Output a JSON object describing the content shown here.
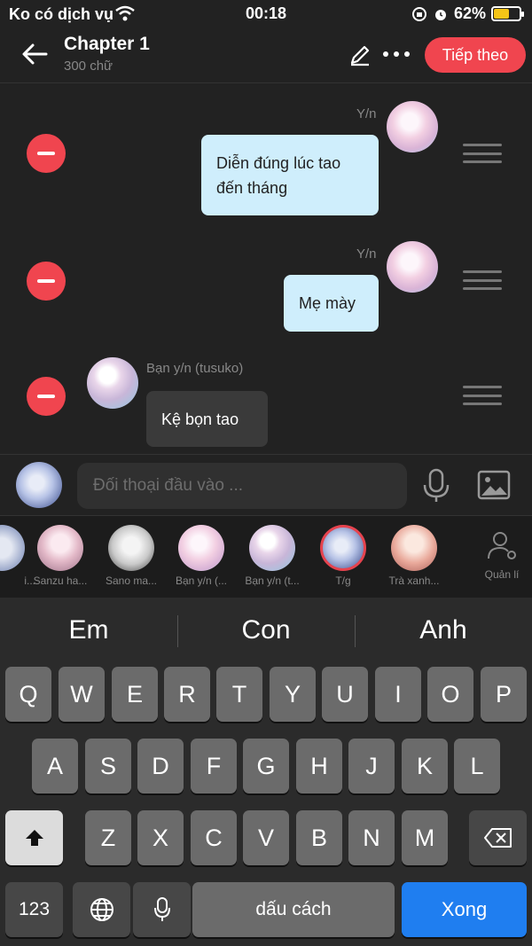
{
  "status_bar": {
    "carrier": "Ko có dịch vụ",
    "time": "00:18",
    "battery_percent": "62%",
    "battery_level": 0.62
  },
  "header": {
    "title": "Chapter 1",
    "subtitle": "300 chữ",
    "next_label": "Tiếp theo"
  },
  "messages": [
    {
      "sender": "Y/n",
      "text_lines": [
        "Diễn đúng lúc tao",
        "đến tháng"
      ],
      "side": "right"
    },
    {
      "sender": "Y/n",
      "text_lines": [
        "Mẹ mày"
      ],
      "side": "right"
    },
    {
      "sender": "Bạn y/n (tusuko)",
      "text_lines": [
        "Kệ bọn tao"
      ],
      "side": "left"
    }
  ],
  "composer": {
    "placeholder": "Đối thoại đầu vào ..."
  },
  "characters": [
    {
      "label": "i..."
    },
    {
      "label": "Sanzu ha..."
    },
    {
      "label": "Sano ma..."
    },
    {
      "label": "Bạn y/n (..."
    },
    {
      "label": "Bạn y/n (t..."
    },
    {
      "label": "T/g"
    },
    {
      "label": "Trà xanh..."
    }
  ],
  "manage_label": "Quản lí",
  "keyboard": {
    "suggestions": [
      "Em",
      "Con",
      "Anh"
    ],
    "row1": [
      "Q",
      "W",
      "E",
      "R",
      "T",
      "Y",
      "U",
      "I",
      "O",
      "P"
    ],
    "row2": [
      "A",
      "S",
      "D",
      "F",
      "G",
      "H",
      "J",
      "K",
      "L"
    ],
    "row3": [
      "Z",
      "X",
      "C",
      "V",
      "B",
      "N",
      "M"
    ],
    "numbers_label": "123",
    "space_label": "dấu cách",
    "done_label": "Xong"
  }
}
